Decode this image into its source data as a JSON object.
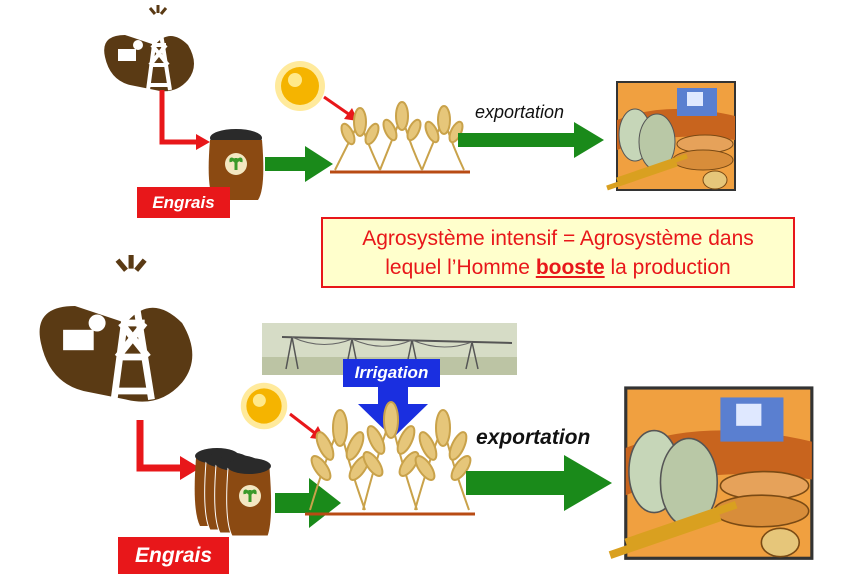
{
  "top": {
    "fertilizer_label": "Engrais",
    "export_label": "exportation"
  },
  "bottom": {
    "fertilizer_label": "Engrais",
    "export_label": "exportation",
    "irrigation_label": "Irrigation"
  },
  "definition": {
    "line1": "Agrosystème intensif = Agrosystème dans",
    "line2_pre": "lequel l’Homme ",
    "line2_bold": "booste",
    "line2_post": " la production"
  },
  "colors": {
    "red": "#e8171a",
    "green": "#1a8a1a",
    "blue": "#1a2fe0",
    "brown": "#5a3a14",
    "sun": "#f5b400"
  }
}
